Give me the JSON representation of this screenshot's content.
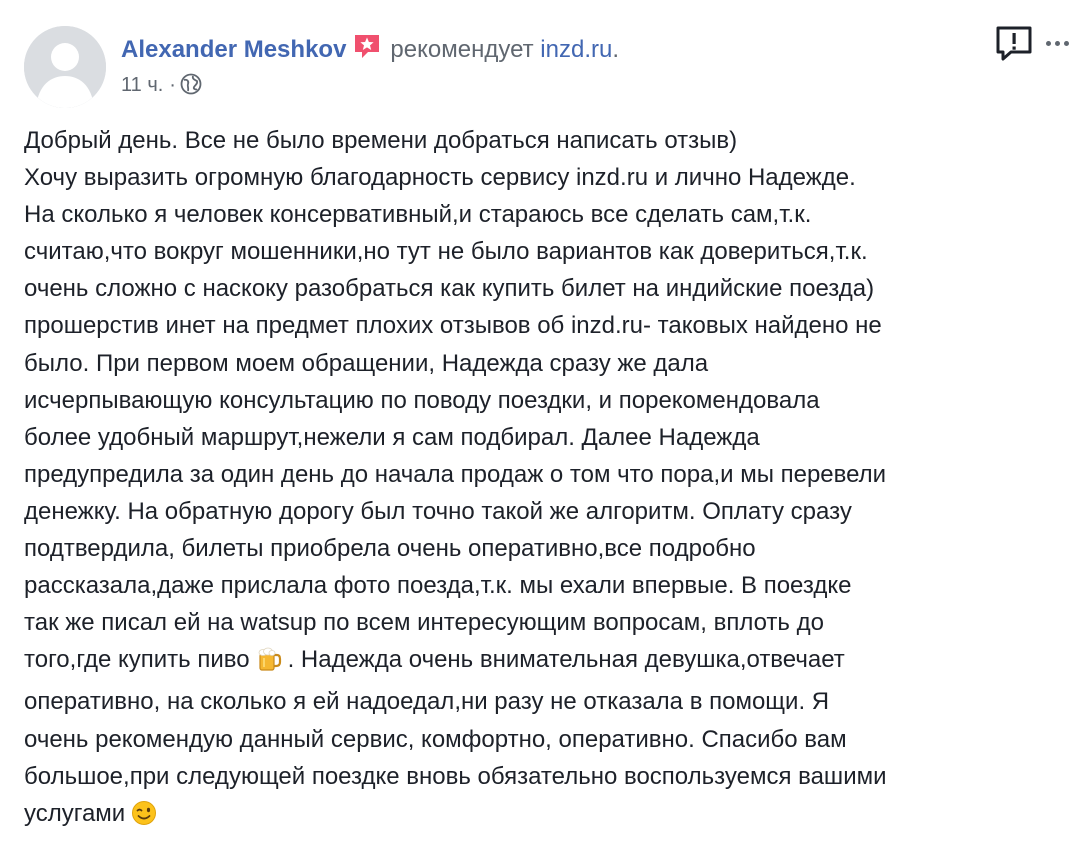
{
  "post": {
    "author_name": "Alexander Meshkov",
    "action_text": "рекомендует",
    "page_link": "inzd.ru",
    "page_link_suffix": ".",
    "timestamp": "11 ч.",
    "separator": "·",
    "audience_icon": "globe-icon",
    "badge_icon": "star-badge-icon",
    "report_icon": "report-exclamation-icon",
    "more_icon": "more-dots-icon",
    "colors": {
      "link": "#4267b2",
      "secondary_text": "#606770",
      "body_text": "#1d2129",
      "badge": "#f0506e"
    },
    "lines": [
      "Добрый день. Все не было времени добраться написать отзыв)",
      "Хочу выразить огромную благодарность сервису inzd.ru и лично Надежде.",
      "На сколько я человек консервативный,и стараюсь все сделать сам,т.к.",
      "считаю,что вокруг мошенники,но тут не было вариантов как довериться,т.к.",
      "очень сложно с наскоку разобраться как купить билет на индийские поезда)",
      "прошерстив инет на предмет плохих отзывов об inzd.ru- таковых найдено не",
      "было. При первом моем обращении, Надежда сразу же дала",
      "исчерпывающую консультацию по поводу поездки, и порекомендовала",
      "более удобный маршрут,нежели я сам подбирал. Далее Надежда",
      "предупредила за один день до начала продаж о том что пора,и мы перевели",
      "денежку. На обратную дорогу был точно такой же алгоритм. Оплату сразу",
      "подтвердила, билеты приобрела очень оперативно,все подробно",
      "рассказала,даже прислала фото поезда,т.к. мы ехали впервые. В поездке",
      "так же писал ей на watsup по всем интересующим вопросам, вплоть до"
    ],
    "line15_before_emoji": "того,где купить пиво",
    "line15_after_emoji": ". Надежда очень внимательная девушка,отвечает",
    "line15_emoji": "beer-mug-emoji",
    "lines_after": [
      "оперативно, на сколько я ей надоедал,ни разу не отказала в помощи. Я",
      "очень рекомендую данный сервис, комфортно, оперативно. Спасибо вам",
      "большое,при следующей поездке вновь обязательно воспользуемся вашими"
    ],
    "last_line_text": "услугами",
    "last_line_emoji": "winking-face-emoji"
  }
}
